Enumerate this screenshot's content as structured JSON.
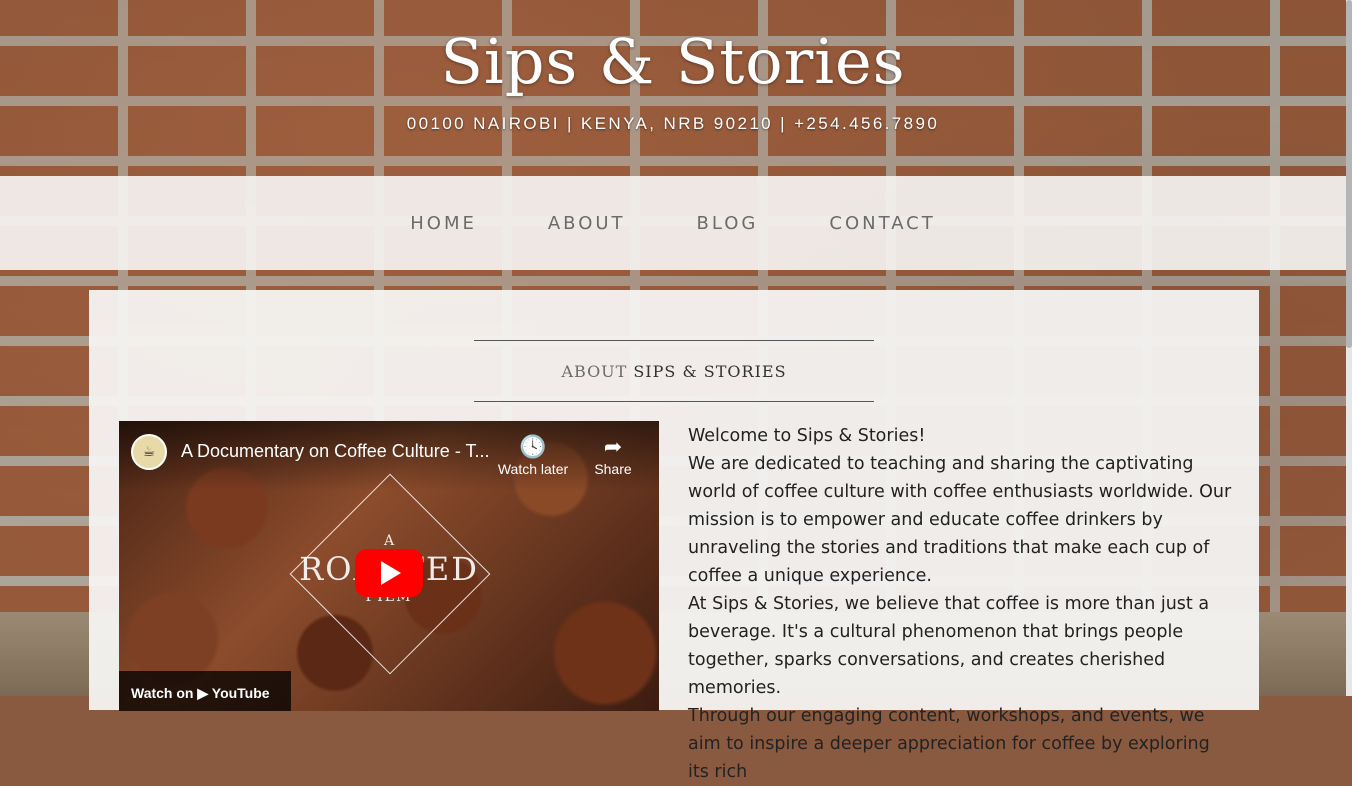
{
  "site": {
    "title": "Sips & Stories",
    "address": "00100 NAIROBI | KENYA, NRB 90210 | +254.456.7890"
  },
  "nav": {
    "items": [
      {
        "label": "HOME"
      },
      {
        "label": "ABOUT"
      },
      {
        "label": "BLOG"
      },
      {
        "label": "CONTACT"
      }
    ]
  },
  "section": {
    "title_light": "ABOUT",
    "title_bold": "SIPS & STORIES"
  },
  "video": {
    "title": "A Documentary on Coffee Culture - T...",
    "watch_later": "Watch later",
    "share": "Share",
    "logo_a": "A",
    "logo_main": "ROASTED",
    "logo_sub": "FILM",
    "watch_on": "Watch on  ▶ YouTube",
    "icons": {
      "watch_later": "clock-icon",
      "share": "share-icon",
      "play": "play-icon"
    }
  },
  "about": {
    "paragraphs": [
      "Welcome to Sips & Stories!",
      "We are dedicated to teaching and sharing the captivating world of coffee culture with coffee enthusiasts worldwide. Our mission is to empower and educate coffee drinkers by unraveling the stories and traditions that make each cup of coffee a unique experience.",
      "At Sips & Stories, we believe that coffee is more than just a beverage. It's a cultural phenomenon that brings people together, sparks conversations, and creates cherished memories.",
      "Through our engaging content, workshops, and events, we aim to inspire a deeper appreciation for coffee by exploring its rich"
    ]
  },
  "colors": {
    "nav_bg": "#f4f2f0",
    "nav_text": "#6b6b6b",
    "play_red": "#ff0000"
  }
}
